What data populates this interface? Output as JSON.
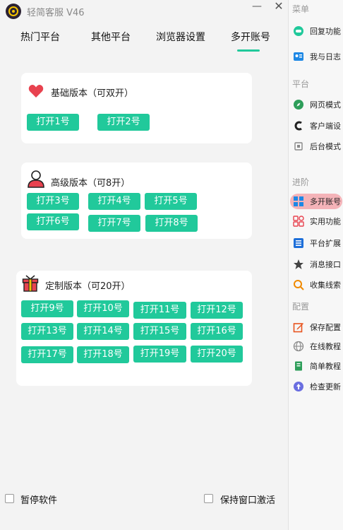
{
  "app": {
    "title": "轻简客服 V46",
    "minimize": "—",
    "close": "✕"
  },
  "tabs": [
    {
      "label": "热门平台"
    },
    {
      "label": "其他平台"
    },
    {
      "label": "浏览器设置"
    },
    {
      "label": "多开账号"
    }
  ],
  "active_tab": "多开账号",
  "cards": {
    "basic": {
      "title": "基础版本（可双开）",
      "buttons": [
        "打开1号",
        "打开2号"
      ]
    },
    "advanced": {
      "title": "高级版本（可8开）",
      "buttons": [
        "打开3号",
        "打开4号",
        "打开5号",
        "打开6号",
        "打开7号",
        "打开8号"
      ]
    },
    "custom": {
      "title": "定制版本（可20开）",
      "buttons": [
        "打开9号",
        "打开10号",
        "打开11号",
        "打开12号",
        "打开13号",
        "打开14号",
        "打开15号",
        "打开16号",
        "打开17号",
        "打开18号",
        "打开19号",
        "打开20号"
      ]
    }
  },
  "footer": {
    "pause": "暂停软件",
    "keep_active": "保持窗口激活"
  },
  "sidebar": {
    "sections": [
      "菜单",
      "平台",
      "进阶",
      "配置"
    ],
    "items": [
      {
        "label": "回复功能",
        "icon": "reply-icon"
      },
      {
        "label": "我与日志",
        "icon": "id-card-icon"
      },
      {
        "label": "网页模式",
        "icon": "compass-icon"
      },
      {
        "label": "客户端设",
        "icon": "c-logo-icon"
      },
      {
        "label": "后台模式",
        "icon": "background-icon"
      },
      {
        "label": "多开账号",
        "icon": "grid-icon",
        "active": true
      },
      {
        "label": "实用功能",
        "icon": "tools-icon"
      },
      {
        "label": "平台扩展",
        "icon": "list-icon"
      },
      {
        "label": "消息接口",
        "icon": "star-icon"
      },
      {
        "label": "收集线索",
        "icon": "search-icon"
      },
      {
        "label": "保存配置",
        "icon": "edit-icon"
      },
      {
        "label": "在线教程",
        "icon": "globe-icon"
      },
      {
        "label": "简单教程",
        "icon": "book-icon"
      },
      {
        "label": "检查更新",
        "icon": "update-icon"
      }
    ]
  },
  "colors": {
    "accent": "#21c99b",
    "active_side": "#f4b3b8"
  }
}
